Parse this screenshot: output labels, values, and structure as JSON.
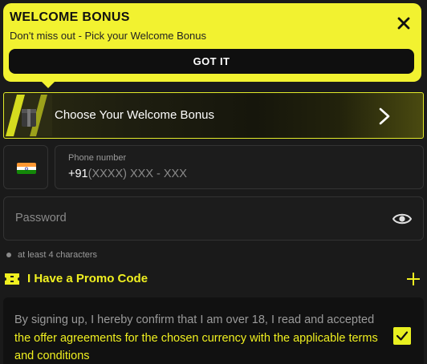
{
  "banner": {
    "title": "WELCOME BONUS",
    "subtitle": "Don't miss out - Pick your Welcome Bonus",
    "button_label": "GOT IT",
    "close_icon": "close-icon"
  },
  "bonus": {
    "label": "Choose Your Welcome Bonus",
    "chevron_icon": "chevron-right-icon"
  },
  "phone": {
    "country_flag": "india-flag-icon",
    "caption": "Phone number",
    "code": "+91",
    "placeholder": "(XXXX) XXX - XXX"
  },
  "password": {
    "placeholder": "Password",
    "eye_icon": "eye-icon",
    "hint": "at least 4 characters"
  },
  "promo": {
    "label": "I Have a Promo Code",
    "icon": "ticket-icon",
    "plus_icon": "plus-icon"
  },
  "terms": {
    "text_plain": "By signing up, I hereby confirm that I am over 18, I read and accepted ",
    "text_link": "the offer agreements for the chosen currency with the applicable terms and conditions",
    "checked": true
  },
  "colors": {
    "accent": "#f0f020",
    "background": "#1a1a1a",
    "banner": "#f2f230"
  }
}
